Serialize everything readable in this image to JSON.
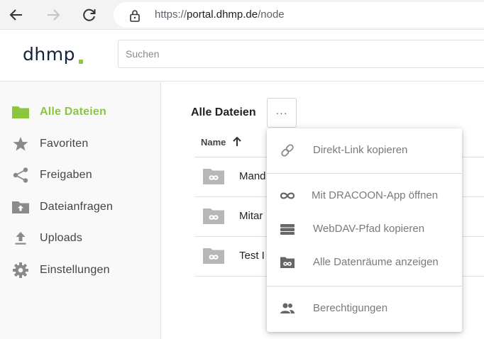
{
  "browser": {
    "url_scheme": "https://",
    "url_host": "portal.dhmp.de",
    "url_path": "/node"
  },
  "header": {
    "logo_text": "dhmp",
    "search_placeholder": "Suchen"
  },
  "sidebar": {
    "items": [
      {
        "label": "Alle Dateien",
        "icon": "folder-icon",
        "active": true
      },
      {
        "label": "Favoriten",
        "icon": "star-icon"
      },
      {
        "label": "Freigaben",
        "icon": "share-icon"
      },
      {
        "label": "Dateianfragen",
        "icon": "folder-upload-icon"
      },
      {
        "label": "Uploads",
        "icon": "upload-icon"
      },
      {
        "label": "Einstellungen",
        "icon": "gear-icon"
      }
    ]
  },
  "main": {
    "title": "Alle Dateien",
    "more_label": "···",
    "column_name": "Name",
    "rows": [
      {
        "name": "Mand"
      },
      {
        "name": "Mitar"
      },
      {
        "name": "Test I"
      }
    ]
  },
  "menu": {
    "items": [
      {
        "label": "Direkt-Link kopieren",
        "icon": "link-icon"
      },
      {
        "label": "Mit DRACOON-App öffnen",
        "icon": "dracoon-icon"
      },
      {
        "label": "WebDAV-Pfad kopieren",
        "icon": "drive-icon"
      },
      {
        "label": "Alle Datenräume anzeigen",
        "icon": "dataroom-icon"
      },
      {
        "label": "Berechtigungen",
        "icon": "people-icon"
      }
    ]
  },
  "colors": {
    "accent": "#8cc63f",
    "brand_dark": "#13233d",
    "icon_grey": "#8a8a8a"
  }
}
